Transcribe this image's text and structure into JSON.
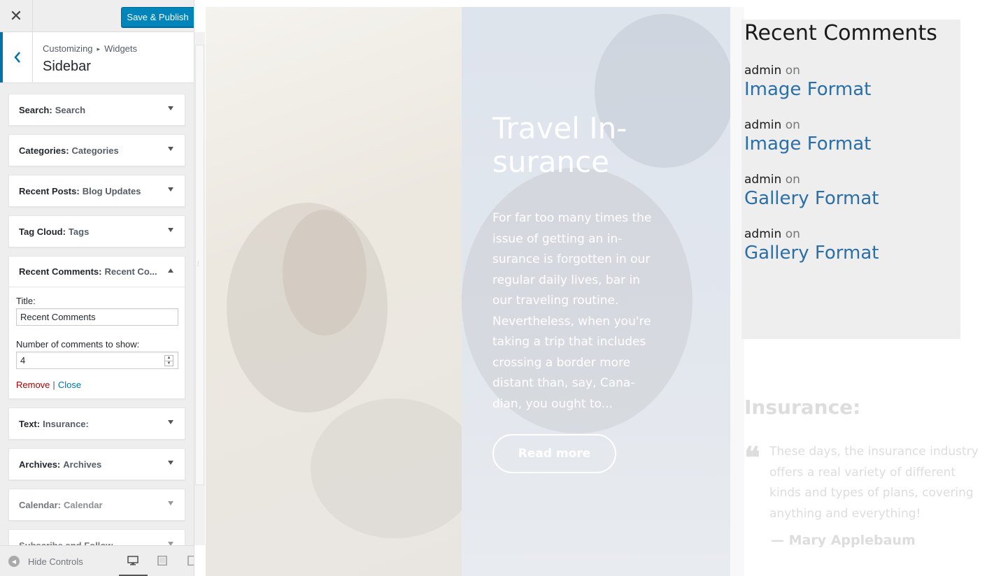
{
  "header": {
    "close_label": "✕",
    "save_label": "Save & Publish"
  },
  "section": {
    "breadcrumb_root": "Customizing",
    "breadcrumb_sep": "▸",
    "breadcrumb_current": "Widgets",
    "title": "Sidebar"
  },
  "widgets": [
    {
      "name": "Search:",
      "title": "Search"
    },
    {
      "name": "Categories:",
      "title": "Categories"
    },
    {
      "name": "Recent Posts:",
      "title": "Blog Updates"
    },
    {
      "name": "Tag Cloud:",
      "title": "Tags"
    },
    {
      "name": "Recent Comments:",
      "title": "Recent Co..."
    },
    {
      "name": "Text:",
      "title": "Insurance:"
    },
    {
      "name": "Archives:",
      "title": "Archives"
    },
    {
      "name": "Calendar:",
      "title": "Calendar"
    },
    {
      "name": "Subscribe and Follow",
      "title": ""
    }
  ],
  "recent_comments_form": {
    "title_label": "Title:",
    "title_value": "Recent Comments",
    "number_label": "Number of comments to show:",
    "number_value": "4",
    "remove_label": "Remove",
    "separator": "|",
    "close_label": "Close"
  },
  "footer": {
    "hide_controls_label": "Hide Controls"
  },
  "preview": {
    "hero_title": "Travel In-surance",
    "hero_text": "For far too many times the issue of getting an in-surance is forgotten in our regular daily lives, bar in our traveling routine. Nevertheless, when you're taking a trip that includes crossing a border more distant than, say, Cana-dian, you ought to...",
    "read_more_label": "Read more",
    "recent_comments_title": "Recent Comments",
    "comments": [
      {
        "author": "admin",
        "on": "on",
        "post": "Image Format"
      },
      {
        "author": "admin",
        "on": "on",
        "post": "Image Format"
      },
      {
        "author": "admin",
        "on": "on",
        "post": "Gallery Format"
      },
      {
        "author": "admin",
        "on": "on",
        "post": "Gallery Format"
      }
    ],
    "insurance_title": "Insurance:",
    "quote_mark": "❝",
    "quote_text": "These days, the insurance industry offers a real variety of different kinds and types of plans, covering anything and everything!",
    "quote_author": "— Mary Applebaum"
  },
  "colors": {
    "accent": "#0085ba",
    "link": "#2a6fa8",
    "remove": "#aa0000"
  }
}
